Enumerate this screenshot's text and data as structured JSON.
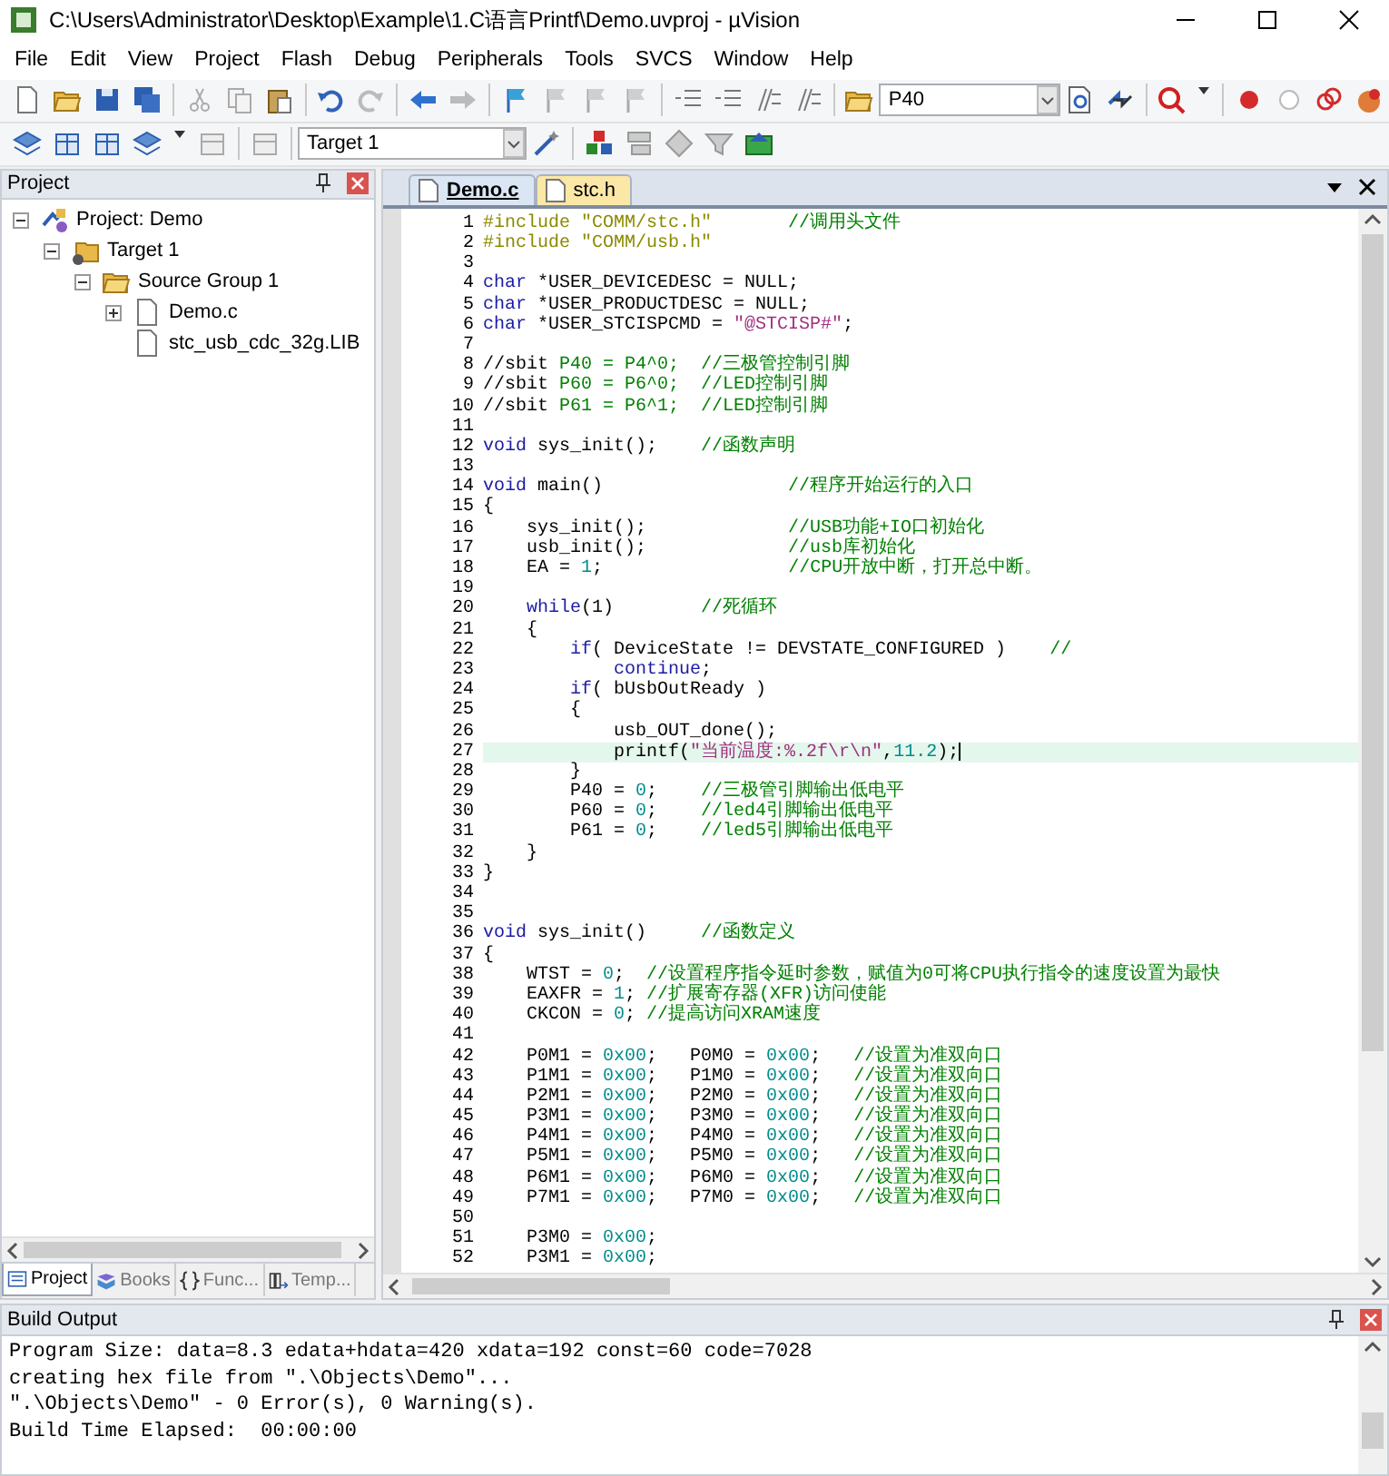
{
  "window": {
    "title": "C:\\Users\\Administrator\\Desktop\\Example\\1.C语言Printf\\Demo.uvproj - µVision"
  },
  "menu": [
    "File",
    "Edit",
    "View",
    "Project",
    "Flash",
    "Debug",
    "Peripherals",
    "Tools",
    "SVCS",
    "Window",
    "Help"
  ],
  "toolbar": {
    "find_combo": "P40",
    "target_combo": "Target 1"
  },
  "project_panel": {
    "title": "Project",
    "tree": [
      {
        "kind": "project",
        "label": "Project: Demo",
        "expanded": true,
        "children": [
          {
            "kind": "target",
            "label": "Target 1",
            "expanded": true,
            "children": [
              {
                "kind": "group",
                "label": "Source Group 1",
                "expanded": true,
                "children": [
                  {
                    "kind": "file",
                    "label": "Demo.c",
                    "expanded": false
                  },
                  {
                    "kind": "file",
                    "label": "stc_usb_cdc_32g.LIB"
                  }
                ]
              }
            ]
          }
        ]
      }
    ],
    "tabs": [
      {
        "label": "Project",
        "selected": true
      },
      {
        "label": "Books",
        "selected": false
      },
      {
        "label": "Func...",
        "selected": false
      },
      {
        "label": "Temp...",
        "selected": false
      }
    ]
  },
  "editor": {
    "tabs": [
      {
        "label": "Demo.c",
        "selected": true
      },
      {
        "label": "stc.h",
        "selected": false
      }
    ],
    "lines": [
      {
        "num": "1",
        "current": false,
        "segments": [
          {
            "kind": "pp",
            "text": "#include \"COMM/stc.h\"       "
          },
          {
            "kind": "cmt",
            "text": "//调用头文件"
          }
        ]
      },
      {
        "num": "2",
        "current": false,
        "segments": [
          {
            "kind": "pp",
            "text": "#include \"COMM/usb.h\""
          }
        ]
      },
      {
        "num": "3",
        "current": false
      },
      {
        "num": "4",
        "current": false,
        "segments": [
          {
            "kind": "kw",
            "text": "char"
          },
          {
            "kind": "txt",
            "text": " *USER_DEVICEDESC = NULL;"
          }
        ]
      },
      {
        "num": "5",
        "current": false,
        "segments": [
          {
            "kind": "kw",
            "text": "char"
          },
          {
            "kind": "txt",
            "text": " *USER_PRODUCTDESC = NULL;"
          }
        ]
      },
      {
        "num": "6",
        "current": false,
        "segments": [
          {
            "kind": "kw",
            "text": "char"
          },
          {
            "kind": "txt",
            "text": " *USER_STCISPCMD = "
          },
          {
            "kind": "str",
            "text": "\"@STCISP#\""
          },
          {
            "kind": "txt",
            "text": ";"
          }
        ]
      },
      {
        "num": "7",
        "current": false
      },
      {
        "num": "8",
        "current": false,
        "segments": [
          {
            "kind": "txt",
            "text": "//sbit "
          },
          {
            "kind": "cmt",
            "text": "P40 = P4^0;  //三极管控制引脚"
          }
        ]
      },
      {
        "num": "9",
        "current": false,
        "segments": [
          {
            "kind": "txt",
            "text": "//sbit "
          },
          {
            "kind": "cmt",
            "text": "P60 = P6^0;  //LED控制引脚"
          }
        ]
      },
      {
        "num": "10",
        "current": false,
        "segments": [
          {
            "kind": "txt",
            "text": "//sbit "
          },
          {
            "kind": "cmt",
            "text": "P61 = P6^1;  //LED控制引脚"
          }
        ]
      },
      {
        "num": "11",
        "current": false
      },
      {
        "num": "12",
        "current": false,
        "segments": [
          {
            "kind": "kw",
            "text": "void"
          },
          {
            "kind": "txt",
            "text": " sys_init();    "
          },
          {
            "kind": "cmt",
            "text": "//函数声明"
          }
        ]
      },
      {
        "num": "13",
        "current": false
      },
      {
        "num": "14",
        "current": false,
        "segments": [
          {
            "kind": "kw",
            "text": "void"
          },
          {
            "kind": "txt",
            "text": " main()                 "
          },
          {
            "kind": "cmt",
            "text": "//程序开始运行的入口"
          }
        ]
      },
      {
        "num": "15",
        "current": false,
        "segments": [
          {
            "kind": "txt",
            "text": "{"
          }
        ]
      },
      {
        "num": "16",
        "current": false,
        "segments": [
          {
            "kind": "txt",
            "text": "    sys_init();             "
          },
          {
            "kind": "cmt",
            "text": "//USB功能+IO口初始化"
          }
        ]
      },
      {
        "num": "17",
        "current": false,
        "segments": [
          {
            "kind": "txt",
            "text": "    usb_init();             "
          },
          {
            "kind": "cmt",
            "text": "//usb库初始化"
          }
        ]
      },
      {
        "num": "18",
        "current": false,
        "segments": [
          {
            "kind": "txt",
            "text": "    EA = "
          },
          {
            "kind": "num",
            "text": "1"
          },
          {
            "kind": "txt",
            "text": ";                 "
          },
          {
            "kind": "cmt",
            "text": "//CPU开放中断，打开总中断。"
          }
        ]
      },
      {
        "num": "19",
        "current": false
      },
      {
        "num": "20",
        "current": false,
        "segments": [
          {
            "kind": "kw",
            "text": "    while"
          },
          {
            "kind": "txt",
            "text": "(1)        "
          },
          {
            "kind": "cmt",
            "text": "//死循环"
          }
        ]
      },
      {
        "num": "21",
        "current": false,
        "segments": [
          {
            "kind": "txt",
            "text": "    {"
          }
        ]
      },
      {
        "num": "22",
        "current": false,
        "segments": [
          {
            "kind": "kw",
            "text": "        if"
          },
          {
            "kind": "txt",
            "text": "( DeviceState != DEVSTATE_CONFIGURED )    "
          },
          {
            "kind": "cmt",
            "text": "//"
          }
        ]
      },
      {
        "num": "23",
        "current": false,
        "segments": [
          {
            "kind": "kw",
            "text": "            continue"
          },
          {
            "kind": "txt",
            "text": ";"
          }
        ]
      },
      {
        "num": "24",
        "current": false,
        "segments": [
          {
            "kind": "kw",
            "text": "        if"
          },
          {
            "kind": "txt",
            "text": "( bUsbOutReady )"
          }
        ]
      },
      {
        "num": "25",
        "current": false,
        "segments": [
          {
            "kind": "txt",
            "text": "        {"
          }
        ]
      },
      {
        "num": "26",
        "current": false,
        "segments": [
          {
            "kind": "txt",
            "text": "            usb_OUT_done();"
          }
        ]
      },
      {
        "num": "27",
        "current": true,
        "segments": [
          {
            "kind": "txt",
            "text": "            printf("
          },
          {
            "kind": "str",
            "text": "\"当前温度:%.2f\\r\\n\""
          },
          {
            "kind": "txt",
            "text": ","
          },
          {
            "kind": "num",
            "text": "11.2"
          },
          {
            "kind": "txt",
            "text": ");"
          }
        ]
      },
      {
        "num": "28",
        "current": false,
        "segments": [
          {
            "kind": "txt",
            "text": "        }"
          }
        ]
      },
      {
        "num": "29",
        "current": false,
        "segments": [
          {
            "kind": "txt",
            "text": "        P40 = "
          },
          {
            "kind": "num",
            "text": "0"
          },
          {
            "kind": "txt",
            "text": ";    "
          },
          {
            "kind": "cmt",
            "text": "//三极管引脚输出低电平"
          }
        ]
      },
      {
        "num": "30",
        "current": false,
        "segments": [
          {
            "kind": "txt",
            "text": "        P60 = "
          },
          {
            "kind": "num",
            "text": "0"
          },
          {
            "kind": "txt",
            "text": ";    "
          },
          {
            "kind": "cmt",
            "text": "//led4引脚输出低电平"
          }
        ]
      },
      {
        "num": "31",
        "current": false,
        "segments": [
          {
            "kind": "txt",
            "text": "        P61 = "
          },
          {
            "kind": "num",
            "text": "0"
          },
          {
            "kind": "txt",
            "text": ";    "
          },
          {
            "kind": "cmt",
            "text": "//led5引脚输出低电平"
          }
        ]
      },
      {
        "num": "32",
        "current": false,
        "segments": [
          {
            "kind": "txt",
            "text": "    }"
          }
        ]
      },
      {
        "num": "33",
        "current": false,
        "segments": [
          {
            "kind": "txt",
            "text": "}"
          }
        ]
      },
      {
        "num": "34",
        "current": false
      },
      {
        "num": "35",
        "current": false
      },
      {
        "num": "36",
        "current": false,
        "segments": [
          {
            "kind": "kw",
            "text": "void"
          },
          {
            "kind": "txt",
            "text": " sys_init()     "
          },
          {
            "kind": "cmt",
            "text": "//函数定义"
          }
        ]
      },
      {
        "num": "37",
        "current": false,
        "segments": [
          {
            "kind": "txt",
            "text": "{"
          }
        ]
      },
      {
        "num": "38",
        "current": false,
        "segments": [
          {
            "kind": "txt",
            "text": "    WTST = "
          },
          {
            "kind": "num",
            "text": "0"
          },
          {
            "kind": "txt",
            "text": ";  "
          },
          {
            "kind": "cmt",
            "text": "//设置程序指令延时参数，赋值为0可将CPU执行指令的速度设置为最快"
          }
        ]
      },
      {
        "num": "39",
        "current": false,
        "segments": [
          {
            "kind": "txt",
            "text": "    EAXFR = "
          },
          {
            "kind": "num",
            "text": "1"
          },
          {
            "kind": "txt",
            "text": "; "
          },
          {
            "kind": "cmt",
            "text": "//扩展寄存器(XFR)访问使能"
          }
        ]
      },
      {
        "num": "40",
        "current": false,
        "segments": [
          {
            "kind": "txt",
            "text": "    CKCON = "
          },
          {
            "kind": "num",
            "text": "0"
          },
          {
            "kind": "txt",
            "text": "; "
          },
          {
            "kind": "cmt",
            "text": "//提高访问XRAM速度"
          }
        ]
      },
      {
        "num": "41",
        "current": false
      },
      {
        "num": "42",
        "current": false,
        "segments": [
          {
            "kind": "txt",
            "text": "    P0M1 = "
          },
          {
            "kind": "num",
            "text": "0x00"
          },
          {
            "kind": "txt",
            "text": ";   P0M0 = "
          },
          {
            "kind": "num",
            "text": "0x00"
          },
          {
            "kind": "txt",
            "text": ";   "
          },
          {
            "kind": "cmt",
            "text": "//设置为准双向口"
          }
        ]
      },
      {
        "num": "43",
        "current": false,
        "segments": [
          {
            "kind": "txt",
            "text": "    P1M1 = "
          },
          {
            "kind": "num",
            "text": "0x00"
          },
          {
            "kind": "txt",
            "text": ";   P1M0 = "
          },
          {
            "kind": "num",
            "text": "0x00"
          },
          {
            "kind": "txt",
            "text": ";   "
          },
          {
            "kind": "cmt",
            "text": "//设置为准双向口"
          }
        ]
      },
      {
        "num": "44",
        "current": false,
        "segments": [
          {
            "kind": "txt",
            "text": "    P2M1 = "
          },
          {
            "kind": "num",
            "text": "0x00"
          },
          {
            "kind": "txt",
            "text": ";   P2M0 = "
          },
          {
            "kind": "num",
            "text": "0x00"
          },
          {
            "kind": "txt",
            "text": ";   "
          },
          {
            "kind": "cmt",
            "text": "//设置为准双向口"
          }
        ]
      },
      {
        "num": "45",
        "current": false,
        "segments": [
          {
            "kind": "txt",
            "text": "    P3M1 = "
          },
          {
            "kind": "num",
            "text": "0x00"
          },
          {
            "kind": "txt",
            "text": ";   P3M0 = "
          },
          {
            "kind": "num",
            "text": "0x00"
          },
          {
            "kind": "txt",
            "text": ";   "
          },
          {
            "kind": "cmt",
            "text": "//设置为准双向口"
          }
        ]
      },
      {
        "num": "46",
        "current": false,
        "segments": [
          {
            "kind": "txt",
            "text": "    P4M1 = "
          },
          {
            "kind": "num",
            "text": "0x00"
          },
          {
            "kind": "txt",
            "text": ";   P4M0 = "
          },
          {
            "kind": "num",
            "text": "0x00"
          },
          {
            "kind": "txt",
            "text": ";   "
          },
          {
            "kind": "cmt",
            "text": "//设置为准双向口"
          }
        ]
      },
      {
        "num": "47",
        "current": false,
        "segments": [
          {
            "kind": "txt",
            "text": "    P5M1 = "
          },
          {
            "kind": "num",
            "text": "0x00"
          },
          {
            "kind": "txt",
            "text": ";   P5M0 = "
          },
          {
            "kind": "num",
            "text": "0x00"
          },
          {
            "kind": "txt",
            "text": ";   "
          },
          {
            "kind": "cmt",
            "text": "//设置为准双向口"
          }
        ]
      },
      {
        "num": "48",
        "current": false,
        "segments": [
          {
            "kind": "txt",
            "text": "    P6M1 = "
          },
          {
            "kind": "num",
            "text": "0x00"
          },
          {
            "kind": "txt",
            "text": ";   P6M0 = "
          },
          {
            "kind": "num",
            "text": "0x00"
          },
          {
            "kind": "txt",
            "text": ";   "
          },
          {
            "kind": "cmt",
            "text": "//设置为准双向口"
          }
        ]
      },
      {
        "num": "49",
        "current": false,
        "segments": [
          {
            "kind": "txt",
            "text": "    P7M1 = "
          },
          {
            "kind": "num",
            "text": "0x00"
          },
          {
            "kind": "txt",
            "text": ";   P7M0 = "
          },
          {
            "kind": "num",
            "text": "0x00"
          },
          {
            "kind": "txt",
            "text": ";   "
          },
          {
            "kind": "cmt",
            "text": "//设置为准双向口"
          }
        ]
      },
      {
        "num": "50",
        "current": false
      },
      {
        "num": "51",
        "current": false,
        "segments": [
          {
            "kind": "txt",
            "text": "    P3M0 = "
          },
          {
            "kind": "num",
            "text": "0x00"
          },
          {
            "kind": "txt",
            "text": ";"
          }
        ]
      },
      {
        "num": "52",
        "current": false,
        "segments": [
          {
            "kind": "txt",
            "text": "    P3M1 = "
          },
          {
            "kind": "num",
            "text": "0x00"
          },
          {
            "kind": "txt",
            "text": ";"
          }
        ]
      }
    ]
  },
  "build_output": {
    "title": "Build Output",
    "lines": [
      "Program Size: data=8.3 edata+hdata=420 xdata=192 const=60 code=7028",
      "creating hex file from \".\\Objects\\Demo\"...",
      "\".\\Objects\\Demo\" - 0 Error(s), 0 Warning(s).",
      "Build Time Elapsed:  00:00:00"
    ]
  }
}
